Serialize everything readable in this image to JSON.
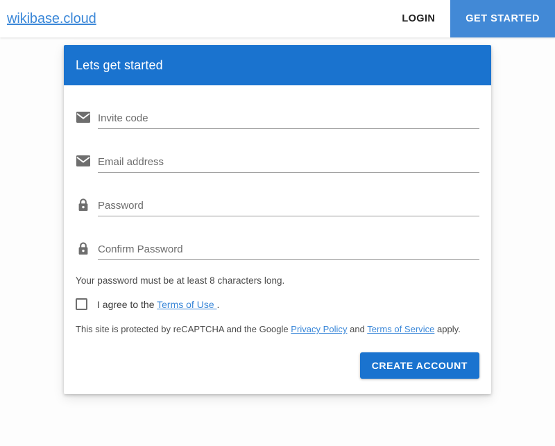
{
  "navbar": {
    "brand": "wikibase.cloud",
    "login_label": "LOGIN",
    "get_started_label": "GET STARTED"
  },
  "card": {
    "title": "Lets get started",
    "fields": [
      {
        "placeholder": "Invite code",
        "value": "",
        "icon": "envelope-icon",
        "type": "text",
        "name": "invite-code"
      },
      {
        "placeholder": "Email address",
        "value": "",
        "icon": "envelope-icon",
        "type": "text",
        "name": "email-address"
      },
      {
        "placeholder": "Password",
        "value": "",
        "icon": "lock-icon",
        "type": "password",
        "name": "password"
      },
      {
        "placeholder": "Confirm Password",
        "value": "",
        "icon": "lock-icon",
        "type": "password",
        "name": "confirm-password"
      }
    ],
    "password_hint": "Your password must be at least 8 characters long.",
    "agree": {
      "prefix": "I agree to the ",
      "link_label": "Terms of Use ",
      "suffix": ".",
      "checked": false
    },
    "recaptcha": {
      "prefix": "This site is protected by reCAPTCHA and the Google ",
      "link1_label": "Privacy Policy",
      "middle": " and ",
      "link2_label": "Terms of Service",
      "suffix": " apply."
    },
    "submit_label": "CREATE ACCOUNT"
  },
  "colors": {
    "header_blue": "#1a73cf",
    "nav_button_blue": "#4289d6",
    "link_blue": "#3a87d8",
    "page_background": "#fdfdfd",
    "icon_gray": "#6e6e6e"
  }
}
